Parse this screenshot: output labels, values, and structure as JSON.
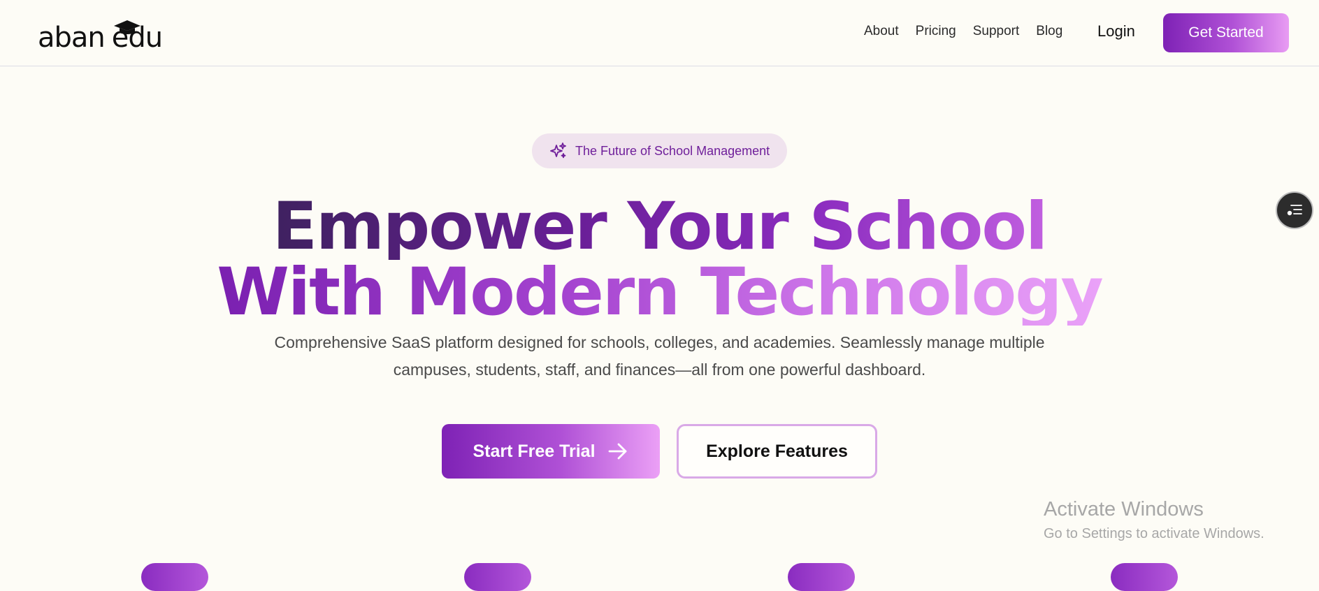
{
  "colors": {
    "accent": "#7e22b5",
    "accent_light": "#eba0f6",
    "background": "#fdfcf6",
    "badge_bg": "#f0e3ee",
    "badge_text": "#6f1f9a"
  },
  "header": {
    "logo": {
      "part1": "aban",
      "part2": "edu",
      "icon": "graduation-cap-icon"
    },
    "nav": [
      {
        "label": "About"
      },
      {
        "label": "Pricing"
      },
      {
        "label": "Support"
      },
      {
        "label": "Blog"
      }
    ],
    "login_label": "Login",
    "cta_label": "Get Started"
  },
  "hero": {
    "badge": {
      "icon": "sparkles-icon",
      "text": "The Future of School Management"
    },
    "headline_line1": "Empower Your School",
    "headline_line2": "With Modern Technology",
    "subtitle_line1": "Comprehensive SaaS platform designed for schools, colleges, and academies. Seamlessly manage multiple",
    "subtitle_line2": "campuses, students, staff, and finances—all from one powerful dashboard.",
    "primary_cta": {
      "label": "Start Free Trial",
      "icon": "arrow-right-icon"
    },
    "secondary_cta": {
      "label": "Explore Features"
    }
  },
  "floating_widget": {
    "icon": "menu-list-icon"
  },
  "watermark": {
    "title": "Activate Windows",
    "subtitle": "Go to Settings to activate Windows."
  }
}
